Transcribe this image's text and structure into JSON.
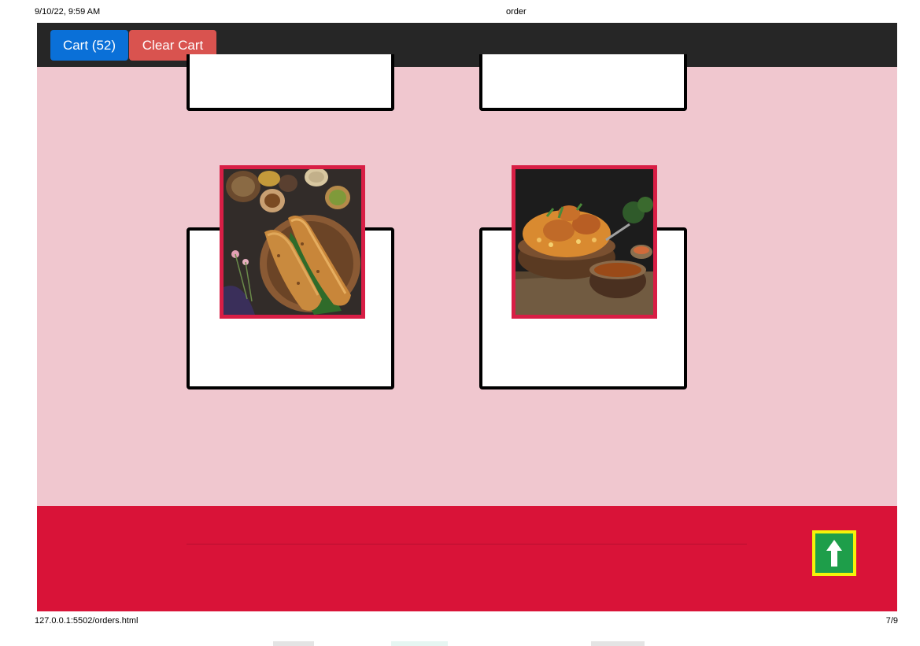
{
  "print_header": {
    "datetime": "9/10/22, 9:59 AM",
    "title": "order"
  },
  "navbar": {
    "cart_label": "Cart (52)",
    "clear_label": "Clear Cart",
    "cart_color": "#0a70d8",
    "clear_color": "#d9534f"
  },
  "products": [
    {
      "image_icon": "dosa-photo"
    },
    {
      "image_icon": "biryani-photo"
    }
  ],
  "footer": {
    "scroll_top_icon": "arrow-up-icon",
    "color": "#d91338"
  },
  "print_footer": {
    "url": "127.0.0.1:5502/orders.html",
    "page": "7/9"
  }
}
